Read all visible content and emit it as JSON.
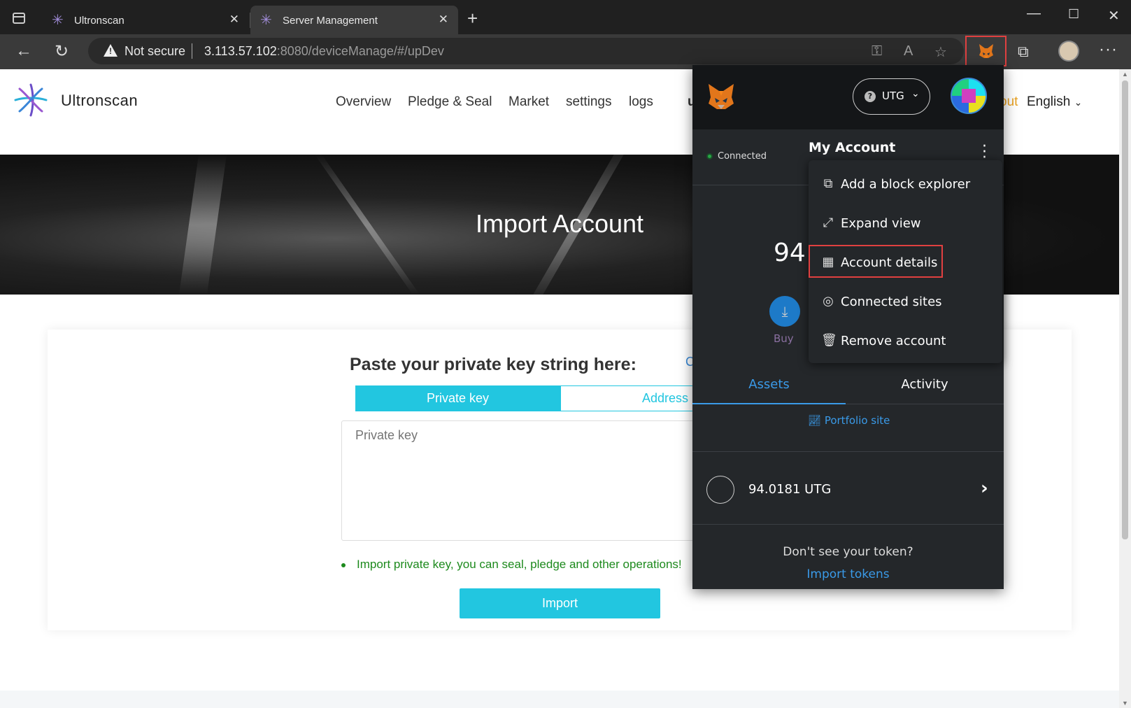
{
  "browser": {
    "tabs": [
      {
        "title": "Ultronscan",
        "active": false
      },
      {
        "title": "Server Management",
        "active": true
      }
    ],
    "security_label": "Not secure",
    "url_host": "3.113.57.102",
    "url_rest": ":8080/deviceManage/#/upDev"
  },
  "site": {
    "logo_text": "Ultronscan",
    "nav": [
      "Overview",
      "Pledge & Seal",
      "Market",
      "settings",
      "logs"
    ],
    "nav_partial": "u",
    "orange_partial": "out",
    "language": "English",
    "hero_title": "Import Account",
    "paste_heading": "Paste your private key string here:",
    "paste_side": "C",
    "tab_private_key": "Private key",
    "tab_address": "Address",
    "key_placeholder": "Private key",
    "note": "Import private key, you can seal, pledge and other operations!",
    "import_button": "Import"
  },
  "metamask": {
    "network": "UTG",
    "connected": "Connected",
    "account_title": "My Account",
    "balance_partial": "94",
    "buy_label": "Buy",
    "menu": [
      {
        "label": "Add a block explorer",
        "icon": "external-link-icon"
      },
      {
        "label": "Expand view",
        "icon": "expand-icon"
      },
      {
        "label": "Account details",
        "icon": "qr-code-icon",
        "highlighted": true
      },
      {
        "label": "Connected sites",
        "icon": "connected-sites-icon"
      },
      {
        "label": "Remove account",
        "icon": "trash-icon"
      }
    ],
    "tab_assets": "Assets",
    "tab_activity": "Activity",
    "portfolio_link": "Portfolio site",
    "token_amount": "94.0181 UTG",
    "dont_see": "Don't see your token?",
    "import_tokens": "Import tokens"
  },
  "colors": {
    "accent_cyan": "#22c6e0",
    "note_green": "#1d8a1d",
    "mm_link_blue": "#3a9ae8",
    "highlight_red": "#e04040"
  }
}
